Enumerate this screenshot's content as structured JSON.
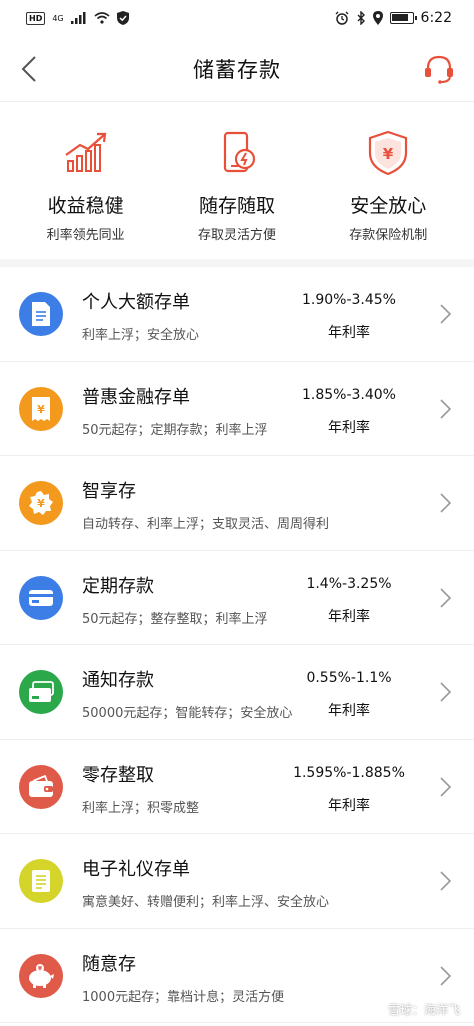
{
  "status_bar": {
    "left_badge": "HD",
    "network": "4G",
    "time": "6:22"
  },
  "nav": {
    "title": "储蓄存款"
  },
  "features": [
    {
      "title": "收益稳健",
      "subtitle": "利率领先同业",
      "icon": "chart-up-icon",
      "color": "#e8503a"
    },
    {
      "title": "随存随取",
      "subtitle": "存取灵活方便",
      "icon": "phone-flash-icon",
      "color": "#e8503a"
    },
    {
      "title": "安全放心",
      "subtitle": "存款保险机制",
      "icon": "shield-yen-icon",
      "color": "#e8503a"
    }
  ],
  "products": [
    {
      "name": "个人大额存单",
      "desc": "利率上浮；安全放心",
      "rate": "1.90%-3.45%",
      "rate_label": "年利率",
      "icon": "document-icon",
      "color": "#3d7ee6"
    },
    {
      "name": "普惠金融存单",
      "desc": "50元起存；定期存款；利率上浮",
      "rate": "1.85%-3.40%",
      "rate_label": "年利率",
      "icon": "receipt-yen-icon",
      "color": "#f39a1e"
    },
    {
      "name": "智享存",
      "desc": "自动转存、利率上浮；支取灵活、周周得利",
      "rate": "",
      "rate_label": "",
      "icon": "yen-burst-icon",
      "color": "#f39a1e"
    },
    {
      "name": "定期存款",
      "desc": "50元起存；整存整取；利率上浮",
      "rate": "1.4%-3.25%",
      "rate_label": "年利率",
      "icon": "card-icon",
      "color": "#3d7ee6"
    },
    {
      "name": "通知存款",
      "desc": "50000元起存；智能转存；安全放心",
      "rate": "0.55%-1.1%",
      "rate_label": "年利率",
      "icon": "card-stack-icon",
      "color": "#2aa84a"
    },
    {
      "name": "零存整取",
      "desc": "利率上浮；积零成整",
      "rate": "1.595%-1.885%",
      "rate_label": "年利率",
      "icon": "wallet-icon",
      "color": "#e05a4a"
    },
    {
      "name": "电子礼仪存单",
      "desc": "寓意美好、转赠便利；利率上浮、安全放心",
      "rate": "",
      "rate_label": "",
      "icon": "certificate-icon",
      "color": "#d4d42a"
    },
    {
      "name": "随意存",
      "desc": "1000元起存；靠档计息；灵活方便",
      "rate": "",
      "rate_label": "",
      "icon": "piggy-bank-icon",
      "color": "#e05a4a"
    }
  ],
  "watermark": {
    "text": "雪球：海洋飞"
  }
}
